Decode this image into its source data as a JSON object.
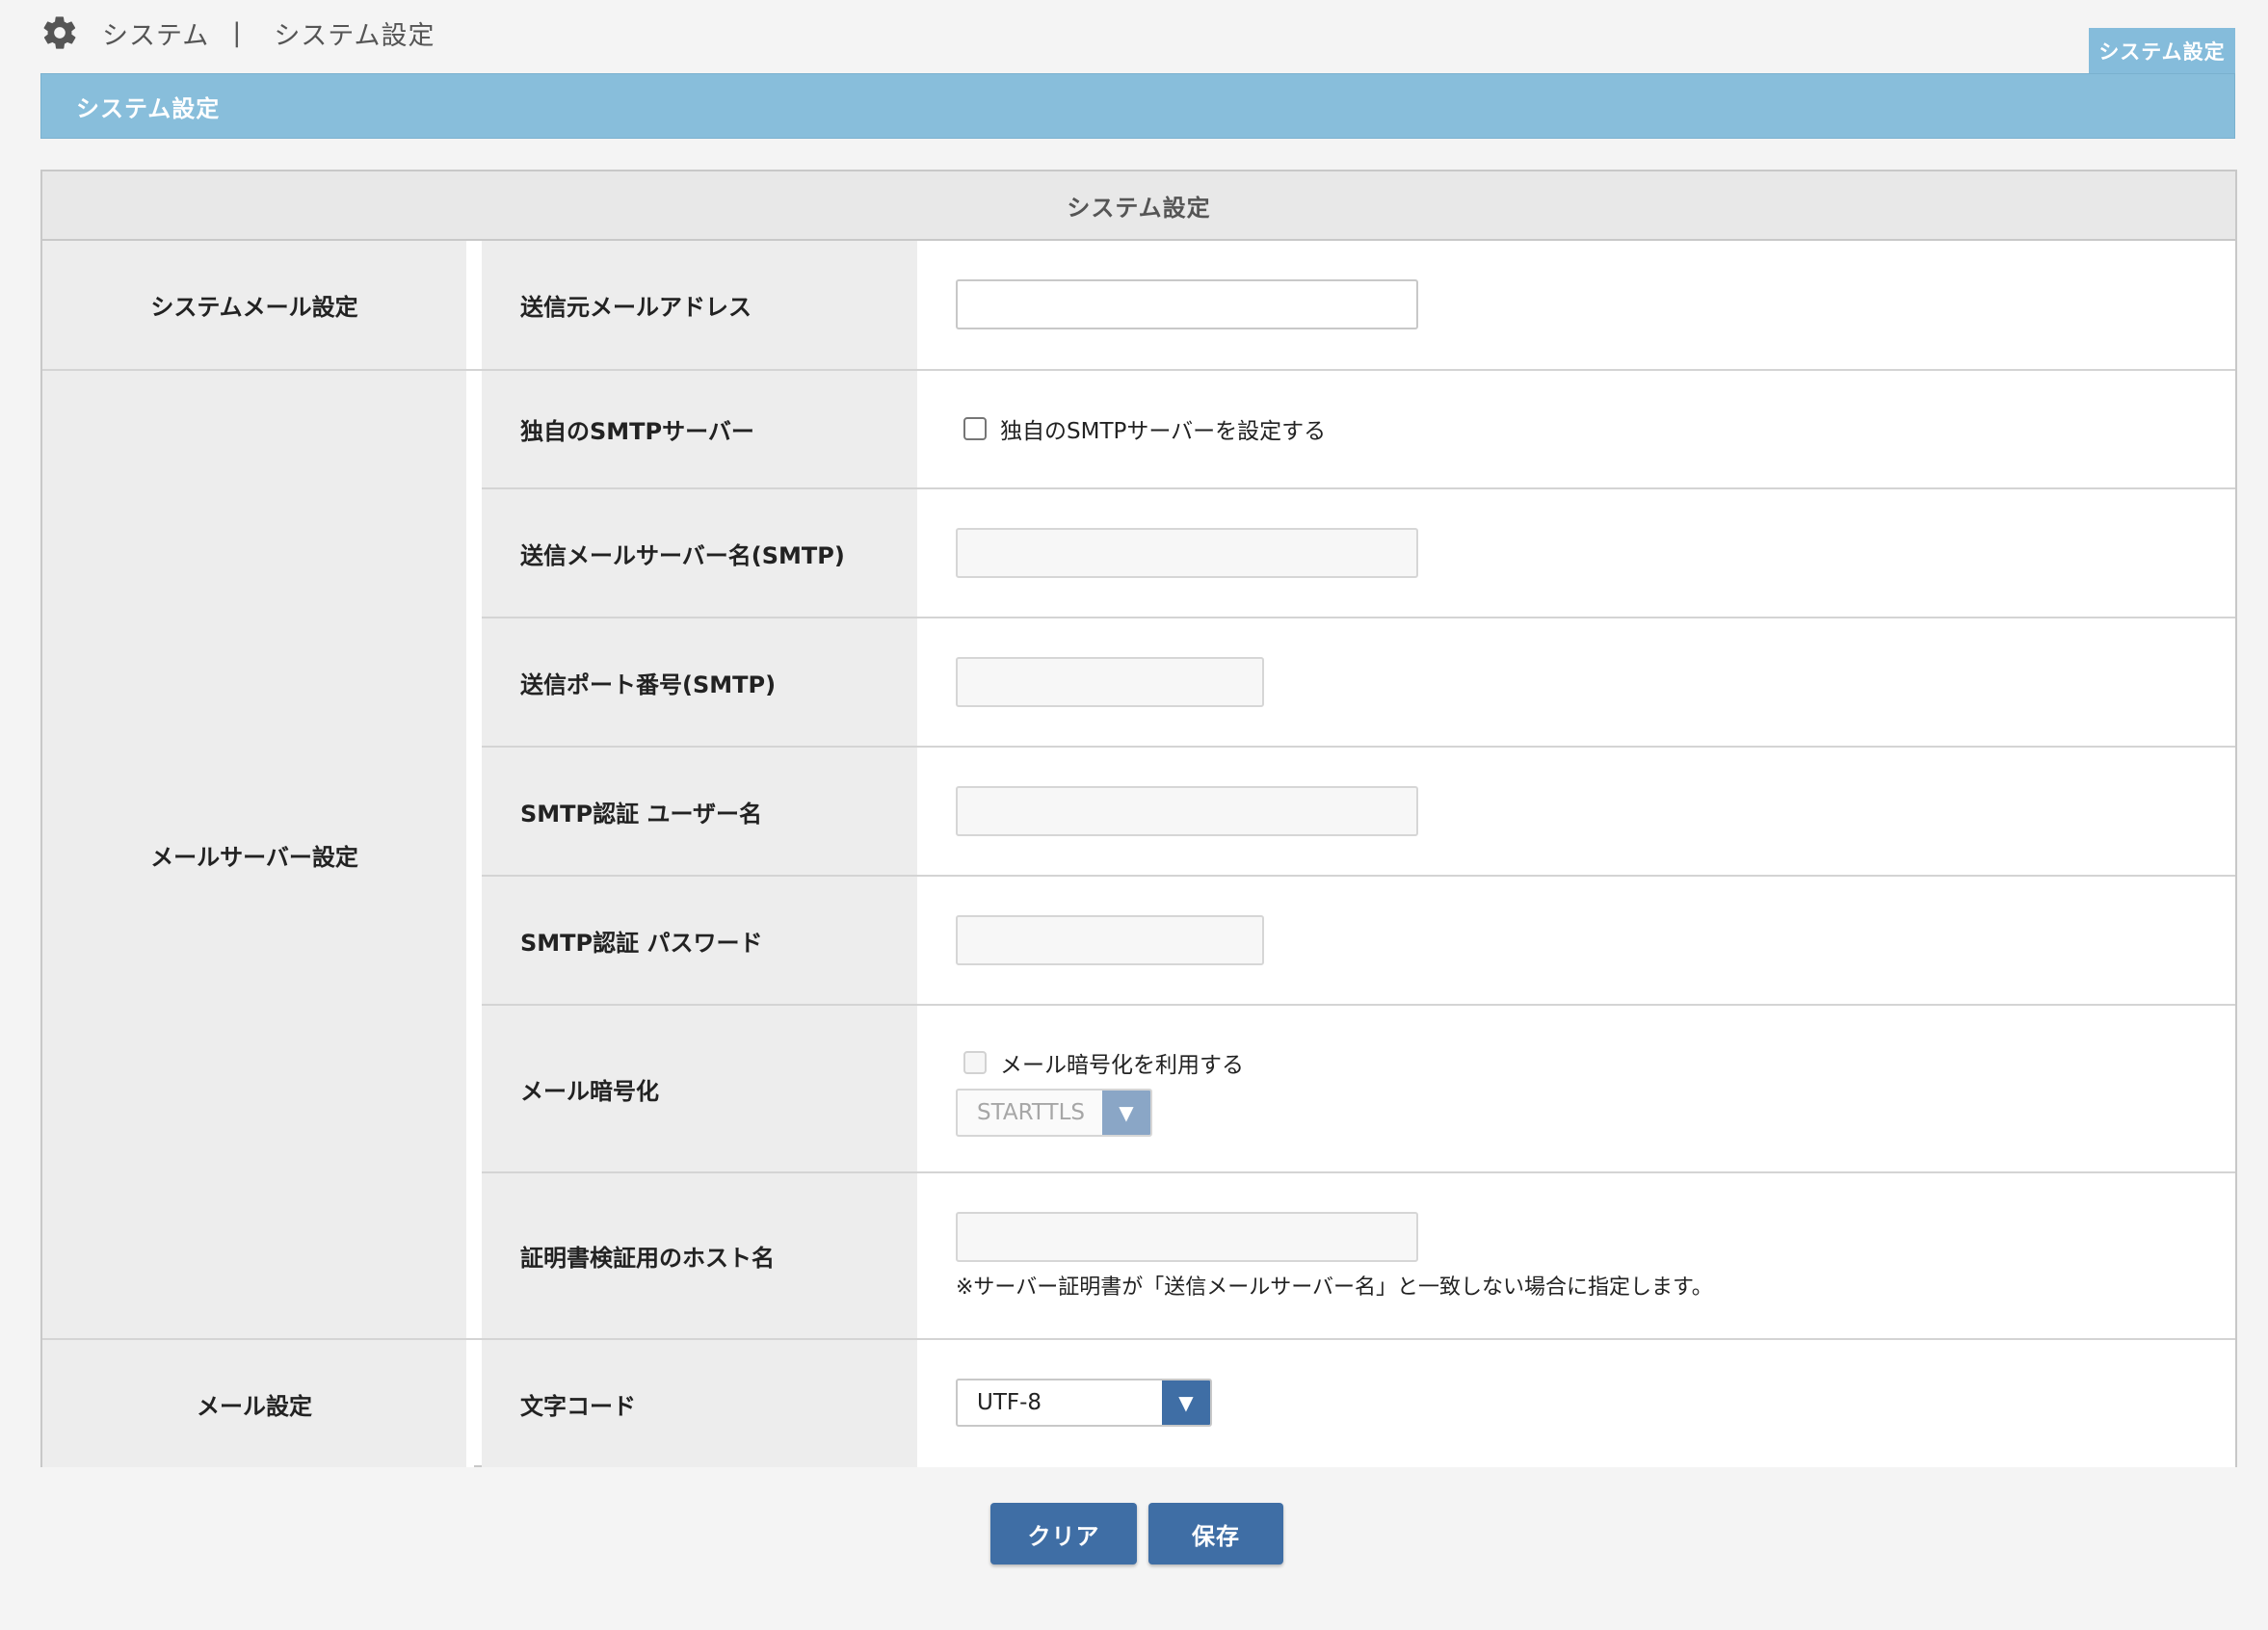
{
  "breadcrumb": {
    "icon": "gear-icon",
    "section": "システム",
    "separator": "|",
    "current": "システム設定"
  },
  "page_tag": "システム設定",
  "title_band": "システム設定",
  "panel": {
    "title": "システム設定",
    "groups": {
      "system_mail": "システムメール設定",
      "mail_server": "メールサーバー設定",
      "mail": "メール設定"
    },
    "rows": {
      "sender_address": {
        "label": "送信元メールアドレス",
        "value": ""
      },
      "custom_smtp": {
        "label": "独自のSMTPサーバー",
        "checkbox_label": "独自のSMTPサーバーを設定する",
        "checked": false
      },
      "smtp_server": {
        "label": "送信メールサーバー名(SMTP)",
        "value": ""
      },
      "smtp_port": {
        "label": "送信ポート番号(SMTP)",
        "value": ""
      },
      "smtp_user": {
        "label": "SMTP認証 ユーザー名",
        "value": ""
      },
      "smtp_password": {
        "label": "SMTP認証 パスワード",
        "value": ""
      },
      "encryption": {
        "label": "メール暗号化",
        "checkbox_label": "メール暗号化を利用する",
        "checked": false,
        "select_value": "STARTTLS"
      },
      "cert_host": {
        "label": "証明書検証用のホスト名",
        "value": "",
        "note": "※サーバー証明書が「送信メールサーバー名」と一致しない場合に指定します。"
      },
      "charset": {
        "label": "文字コード",
        "select_value": "UTF-8"
      }
    }
  },
  "buttons": {
    "clear": "クリア",
    "save": "保存"
  },
  "colors": {
    "band": "#88bedb",
    "button": "#3f6ea5",
    "label_bg": "#ededed"
  }
}
